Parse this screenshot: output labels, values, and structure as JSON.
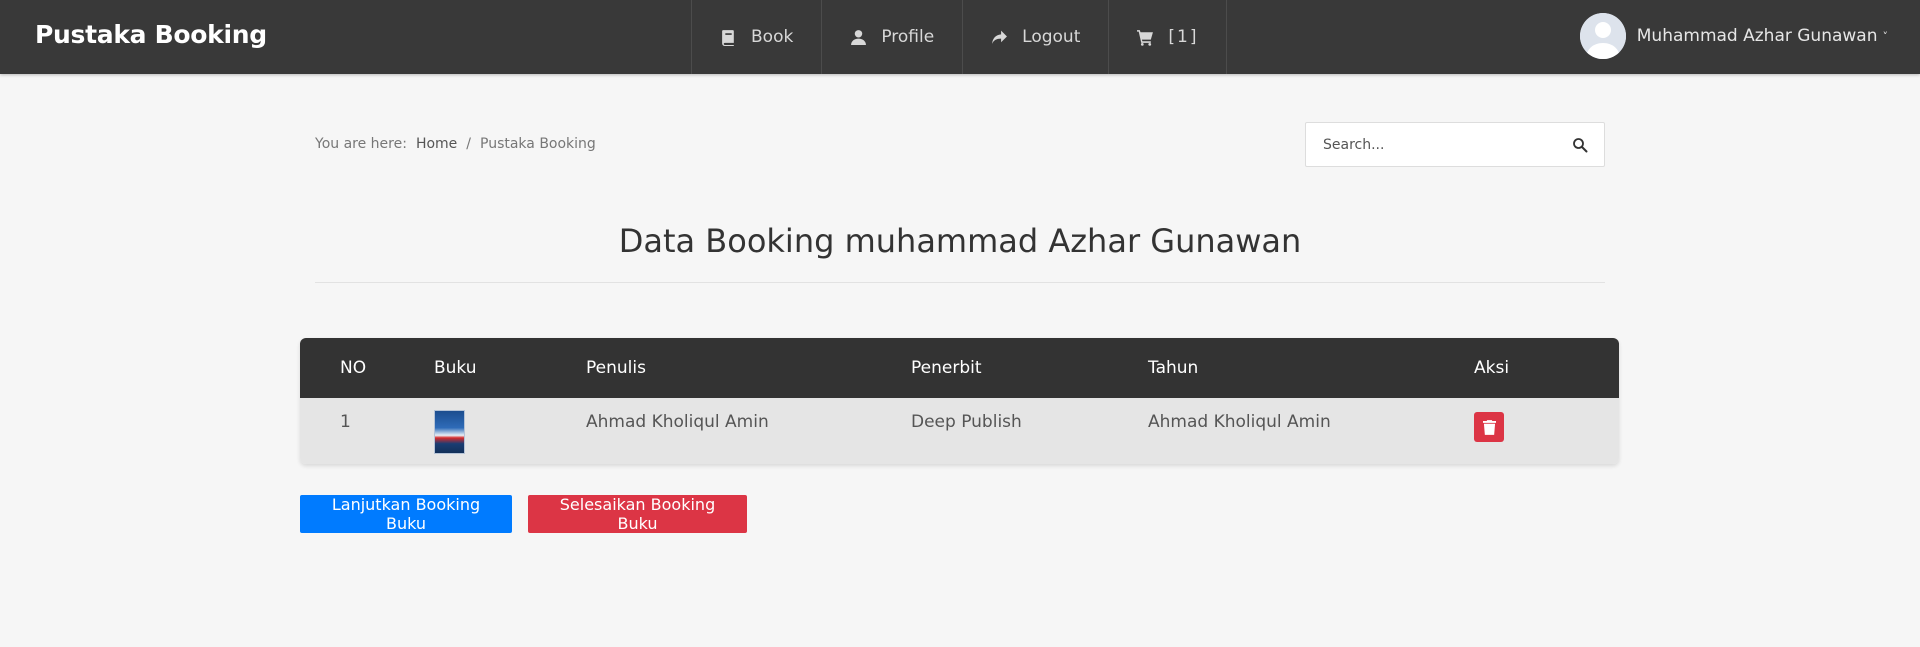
{
  "navbar": {
    "brand": "Pustaka Booking",
    "items": [
      {
        "label": "Book",
        "icon": "book-icon"
      },
      {
        "label": "Profile",
        "icon": "user-icon"
      },
      {
        "label": "Logout",
        "icon": "share-icon"
      }
    ],
    "cart": {
      "icon": "cart-icon",
      "count": "[1]"
    },
    "user": {
      "name": "Muhammad Azhar Gunawan",
      "caret": "˅"
    }
  },
  "breadcrumb": {
    "prefix": "You are here:",
    "items": [
      "Home",
      "Pustaka Booking"
    ],
    "separator": "/"
  },
  "search": {
    "placeholder": "Search..."
  },
  "page": {
    "title": "Data Booking muhammad Azhar Gunawan"
  },
  "table": {
    "headers": [
      "NO",
      "Buku",
      "Penulis",
      "Penerbit",
      "Tahun",
      "Aksi"
    ],
    "rows": [
      {
        "no": "1",
        "penulis": "Ahmad Kholiqul Amin",
        "penerbit": "Deep Publish",
        "tahun": "Ahmad Kholiqul Amin"
      }
    ]
  },
  "actions": {
    "continue_label": "Lanjutkan Booking Buku",
    "finish_label": "Selesaikan Booking Buku"
  },
  "colors": {
    "navbar": "#393939",
    "primary": "#007bff",
    "danger": "#dc3545",
    "table_header": "#333333"
  }
}
